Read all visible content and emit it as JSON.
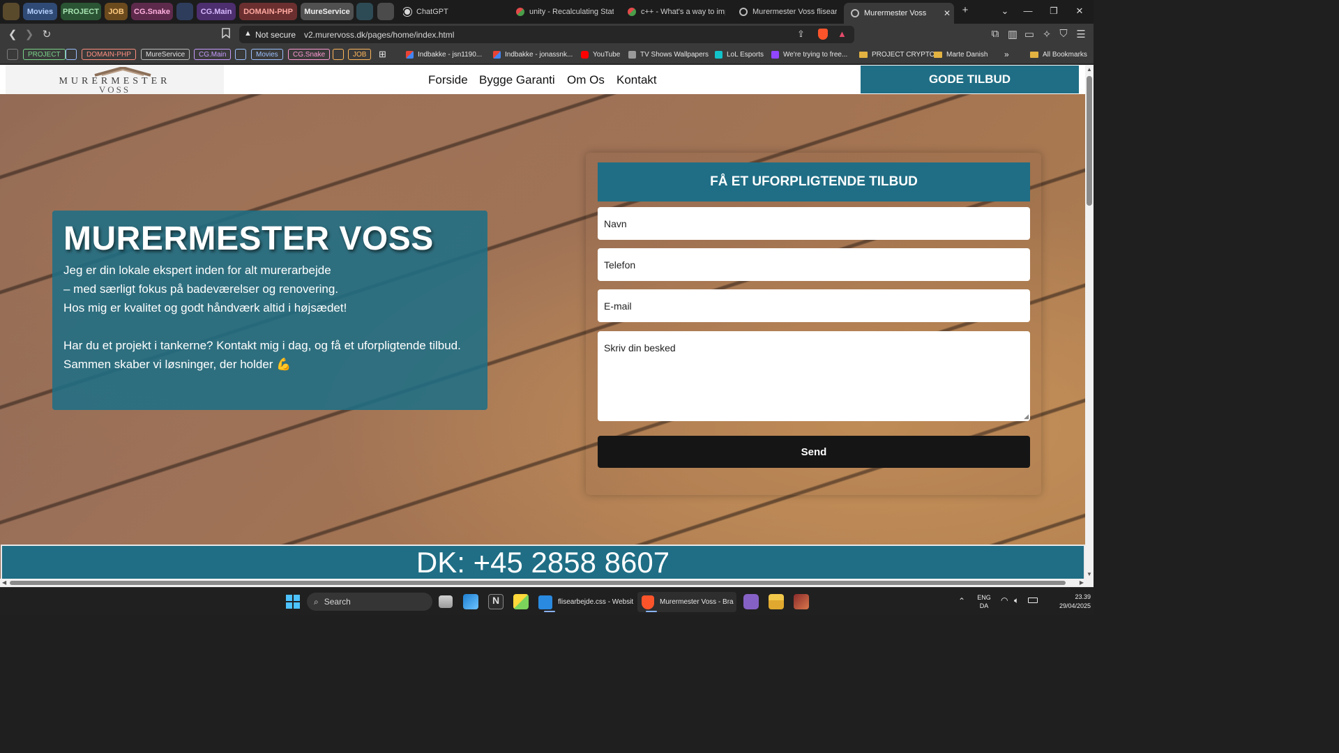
{
  "browser": {
    "tab_groups": [
      {
        "label": "",
        "bg": "#5a4a2c",
        "fg": "#f2d59a"
      },
      {
        "label": "Movies",
        "bg": "#2f4a74",
        "fg": "#b6d0ff"
      },
      {
        "label": "PROJECT",
        "bg": "#2a5433",
        "fg": "#a7e3b1"
      },
      {
        "label": "JOB",
        "bg": "#6b4a1e",
        "fg": "#ffcb7f"
      },
      {
        "label": "CG.Snake",
        "bg": "#5e2a4c",
        "fg": "#ffb0de"
      },
      {
        "label": "",
        "bg": "#2e3d5c",
        "fg": "#cfcfcf"
      },
      {
        "label": "CG.Main",
        "bg": "#4d2e6e",
        "fg": "#d6b8ff"
      },
      {
        "label": "DOMAIN-PHP",
        "bg": "#6b2f2f",
        "fg": "#ffa8a0"
      },
      {
        "label": "MureService",
        "bg": "#505050",
        "fg": "#f0f0f0"
      },
      {
        "label": "",
        "bg": "#2d4b55",
        "fg": "#cfcfcf"
      },
      {
        "label": "",
        "bg": "#4b4b4b",
        "fg": "#cfcfcf"
      }
    ],
    "tabs": [
      {
        "title": "ChatGPT",
        "icon": "chatgpt-icon",
        "active": false
      },
      {
        "title": "unity - Recalculating Stats A",
        "icon": "stackoverflow-icon",
        "active": false
      },
      {
        "title": "c++ - What's a way to impl",
        "icon": "stackoverflow-icon",
        "active": false
      },
      {
        "title": "Murermester Voss flisearbej",
        "icon": "globe-icon",
        "active": false
      },
      {
        "title": "Murermester Voss",
        "icon": "globe-icon",
        "active": true
      }
    ],
    "security_label": "Not secure",
    "url": "v2.murervoss.dk/pages/home/index.html",
    "bookmarks": [
      {
        "label": "PROJECT",
        "type": "group",
        "color": "#7ad58a"
      },
      {
        "label": "DOMAIN-PHP",
        "type": "group",
        "color": "#ff8f80"
      },
      {
        "label": "MureService",
        "type": "group",
        "color": "#e0e0e0"
      },
      {
        "label": "CG.Main",
        "type": "group",
        "color": "#c79cff"
      },
      {
        "label": "Movies",
        "type": "group",
        "color": "#9cc0ff"
      },
      {
        "label": "CG.Snake",
        "type": "group",
        "color": "#ff9ad3"
      },
      {
        "label": "JOB",
        "type": "group",
        "color": "#ffb75a"
      },
      {
        "label": "Indbakke - jsn1190...",
        "type": "link",
        "icon": "gmail-icon"
      },
      {
        "label": "Indbakke - jonassnk...",
        "type": "link",
        "icon": "gmail-icon"
      },
      {
        "label": "YouTube",
        "type": "link",
        "icon": "youtube-icon"
      },
      {
        "label": "TV Shows Wallpapers",
        "type": "link",
        "icon": "wallpaper-icon"
      },
      {
        "label": "LoL Esports",
        "type": "link",
        "icon": "esports-icon"
      },
      {
        "label": "We're trying to free...",
        "type": "link",
        "icon": "twitch-icon"
      },
      {
        "label": "PROJECT CRYPTO",
        "type": "folder"
      },
      {
        "label": "Marte Danish",
        "type": "folder"
      },
      {
        "label": "All Bookmarks",
        "type": "folder"
      }
    ]
  },
  "site": {
    "brand": {
      "line1": "MURERMESTER",
      "line2": "VOSS"
    },
    "nav": [
      "Forside",
      "Bygge Garanti",
      "Om Os",
      "Kontakt"
    ],
    "cta_label": "GODE TILBUD",
    "hero": {
      "title": "MURERMESTER VOSS",
      "lines": [
        "Jeg er din lokale ekspert inden for alt murerarbejde",
        "– med særligt fokus på badeværelser og renovering.",
        "Hos mig er kvalitet og godt håndværk altid i højsædet!",
        "",
        "Har du et projekt i tankerne? Kontakt mig i dag, og få et uforpligtende tilbud.",
        "Sammen skaber vi løsninger, der holder 💪"
      ]
    },
    "form": {
      "title": "FÅ ET UFORPLIGTENDE TILBUD",
      "name_placeholder": "Navn",
      "phone_placeholder": "Telefon",
      "email_placeholder": "E-mail",
      "message_placeholder": "Skriv din besked",
      "submit_label": "Send"
    },
    "phone_banner": "DK: +45 2858 8607"
  },
  "taskbar": {
    "search_label": "Search",
    "apps": [
      {
        "label": "flisearbejde.css - Websit",
        "icon": "vscode-icon"
      },
      {
        "label": "Murermester Voss - Bra",
        "icon": "brave-icon"
      }
    ],
    "lang_top": "ENG",
    "lang_bottom": "DA",
    "time": "23.39",
    "date": "29/04/2025"
  },
  "colors": {
    "brand_teal": "#1f6e85",
    "send_button": "#151515"
  }
}
